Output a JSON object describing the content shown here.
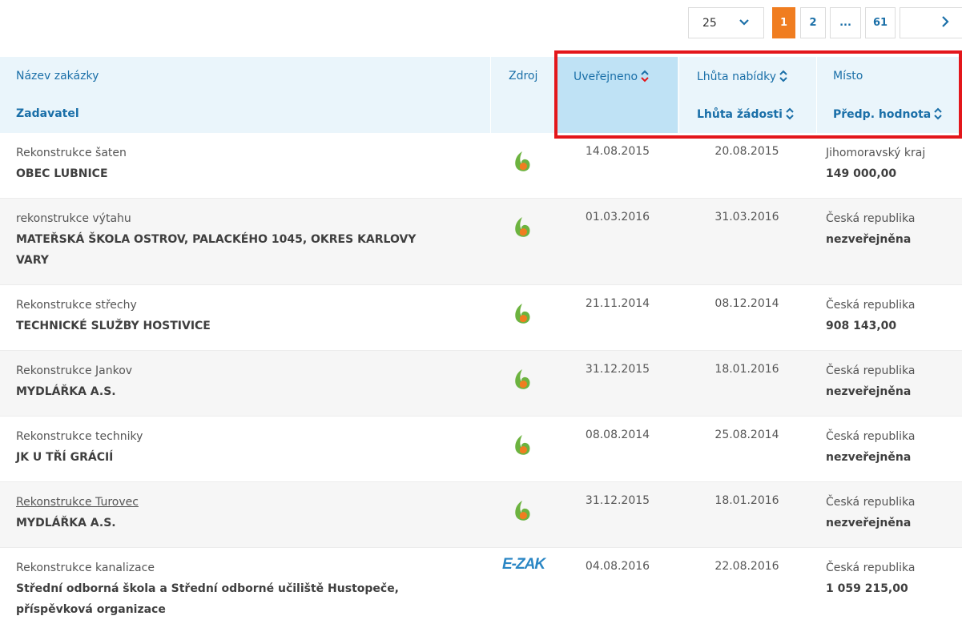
{
  "pager": {
    "per_page": "25",
    "pages": [
      "1",
      "2",
      "...",
      "61"
    ],
    "next": "›"
  },
  "header": {
    "name": "Název zakázky",
    "contractor": "Zadavatel",
    "source": "Zdroj",
    "published": "Uveřejneno",
    "offer_deadline": "Lhůta nabídky",
    "request_deadline": "Lhůta žádosti",
    "place": "Místo",
    "estimated_value": "Předp. hodnota"
  },
  "rows": [
    {
      "name": "Rekonstrukce šaten",
      "contractor": "OBEC LUBNICE",
      "source": "leaf-icon",
      "published": "14.08.2015",
      "deadline": "20.08.2015",
      "place": "Jihomoravský kraj",
      "value": "149 000,00"
    },
    {
      "name": "rekonstrukce výtahu",
      "contractor_l1": "MATEŘSKÁ ŠKOLA OSTROV, PALACKÉHO 1045, OKRES KARLOVY",
      "contractor_l2": "VARY",
      "source": "leaf-icon",
      "published": "01.03.2016",
      "deadline": "31.03.2016",
      "place": "Česká republika",
      "value": "nezveřejněna"
    },
    {
      "name": "Rekonstrukce střechy",
      "contractor": "TECHNICKÉ SLUŽBY HOSTIVICE",
      "source": "leaf-icon",
      "published": "21.11.2014",
      "deadline": "08.12.2014",
      "place": "Česká republika",
      "value": "908 143,00"
    },
    {
      "name": "Rekonstrukce Jankov",
      "contractor": "MYDLÁŘKA A.S.",
      "source": "leaf-icon",
      "published": "31.12.2015",
      "deadline": "18.01.2016",
      "place": "Česká republika",
      "value": "nezveřejněna"
    },
    {
      "name": "Rekonstrukce techniky",
      "contractor": "JK U TŘÍ GRÁCIÍ",
      "source": "leaf-icon",
      "published": "08.08.2014",
      "deadline": "25.08.2014",
      "place": "Česká republika",
      "value": "nezveřejněna"
    },
    {
      "name": "Rekonstrukce Turovec",
      "contractor": "MYDLÁŘKA A.S.",
      "source": "leaf-icon",
      "published": "31.12.2015",
      "deadline": "18.01.2016",
      "place": "Česká republika",
      "value": "nezveřejněna"
    },
    {
      "name": "Rekonstrukce kanalizace",
      "contractor_l1": "Střední odborná škola a Střední odborné učiliště Hustopeče,",
      "contractor_l2": "příspěvková organizace",
      "source": "ezak",
      "source_label": "E-ZAK",
      "published": "04.08.2016",
      "deadline": "22.08.2016",
      "place": "Česká republika",
      "value": "1 059 215,00"
    }
  ],
  "colors": {
    "link": "#1a6fa8",
    "active_page": "#f07d20",
    "header_bg": "#eaf5fb",
    "sorted_bg": "#bfe2f5",
    "highlight_box": "#e3161b",
    "leaf_green": "#6cb33f",
    "leaf_orange": "#f07d20"
  }
}
